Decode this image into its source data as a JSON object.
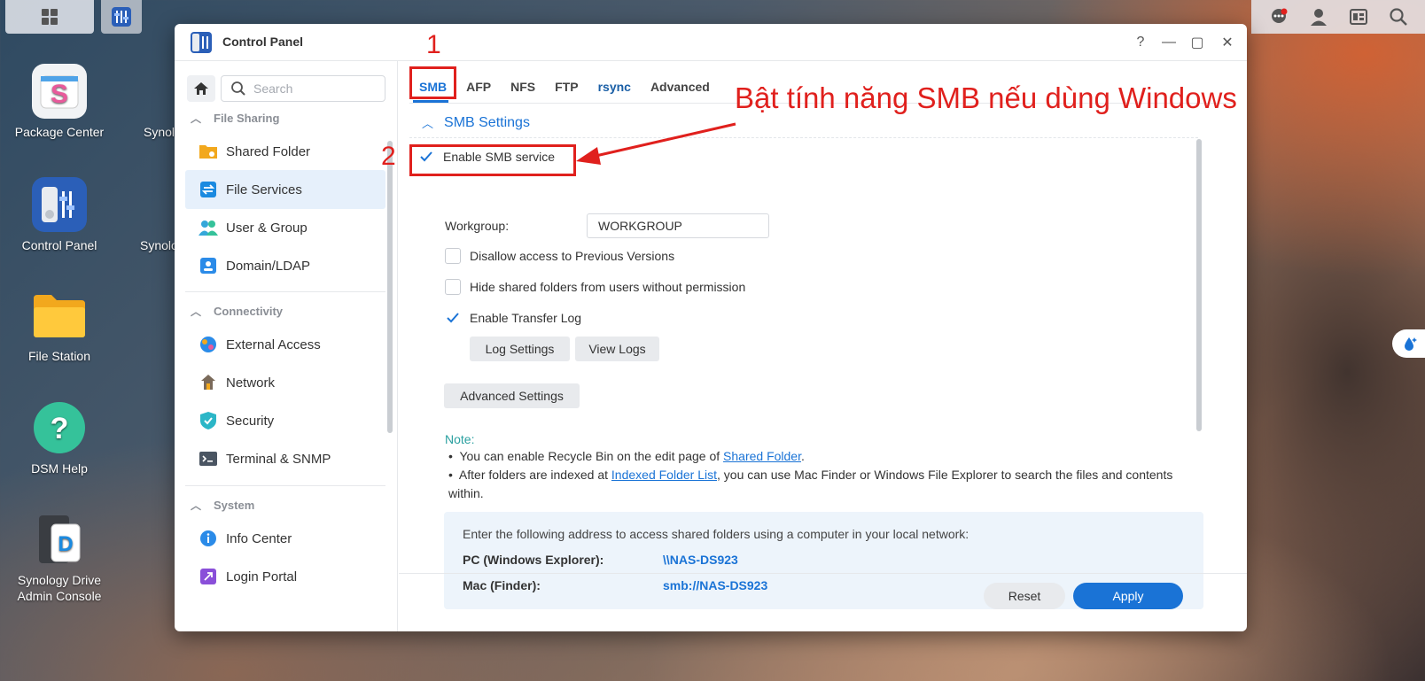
{
  "desktop": {
    "icons": [
      {
        "label": "Package Center",
        "icon": "package-center-icon"
      },
      {
        "label": "Control Panel",
        "icon": "control-panel-icon"
      },
      {
        "label": "File Station",
        "icon": "folder-icon"
      },
      {
        "label": "DSM Help",
        "icon": "help-icon"
      },
      {
        "label": "Synology Drive Admin Console",
        "icon": "drive-icon"
      }
    ],
    "partial_labels": [
      "Synol",
      "Synolo"
    ]
  },
  "window": {
    "title": "Control Panel",
    "controls": {
      "help": "?",
      "minimize": "—",
      "maximize": "▢",
      "close": "✕"
    }
  },
  "sidebar": {
    "search_placeholder": "Search",
    "sections": [
      {
        "title": "File Sharing",
        "items": [
          "Shared Folder",
          "File Services",
          "User & Group",
          "Domain/LDAP"
        ]
      },
      {
        "title": "Connectivity",
        "items": [
          "External Access",
          "Network",
          "Security",
          "Terminal & SNMP"
        ]
      },
      {
        "title": "System",
        "items": [
          "Info Center",
          "Login Portal"
        ]
      }
    ],
    "active_item": "File Services"
  },
  "tabs": [
    "SMB",
    "AFP",
    "NFS",
    "FTP",
    "rsync",
    "Advanced"
  ],
  "active_tab": "SMB",
  "smb": {
    "section_title": "SMB Settings",
    "enable_label": "Enable SMB service",
    "enable_checked": true,
    "workgroup_label": "Workgroup:",
    "workgroup_value": "WORKGROUP",
    "opt_disallow": "Disallow access to Previous Versions",
    "opt_disallow_checked": false,
    "opt_hide": "Hide shared folders from users without permission",
    "opt_hide_checked": false,
    "opt_log": "Enable Transfer Log",
    "opt_log_checked": true,
    "btn_log_settings": "Log Settings",
    "btn_view_logs": "View Logs",
    "btn_advanced": "Advanced Settings"
  },
  "note": {
    "label": "Note:",
    "b1_pre": "You can enable Recycle Bin on the edit page of ",
    "b1_link": "Shared Folder",
    "b1_post": ".",
    "b2_pre": "After folders are indexed at ",
    "b2_link": "Indexed Folder List",
    "b2_post": ", you can use Mac Finder or Windows File Explorer to search the files and contents within."
  },
  "address": {
    "intro": "Enter the following address to access shared folders using a computer in your local network:",
    "pc_label": "PC (Windows Explorer):",
    "pc_value": "\\\\NAS-DS923",
    "mac_label": "Mac (Finder):",
    "mac_value": "smb://NAS-DS923"
  },
  "footer": {
    "reset": "Reset",
    "apply": "Apply"
  },
  "annotations": {
    "num1": "1",
    "num2": "2",
    "callout": "Bật tính năng SMB nếu dùng Windows",
    "color": "#e0201d"
  },
  "colors": {
    "accent": "#1a73d6",
    "note": "#2aa0a0"
  }
}
